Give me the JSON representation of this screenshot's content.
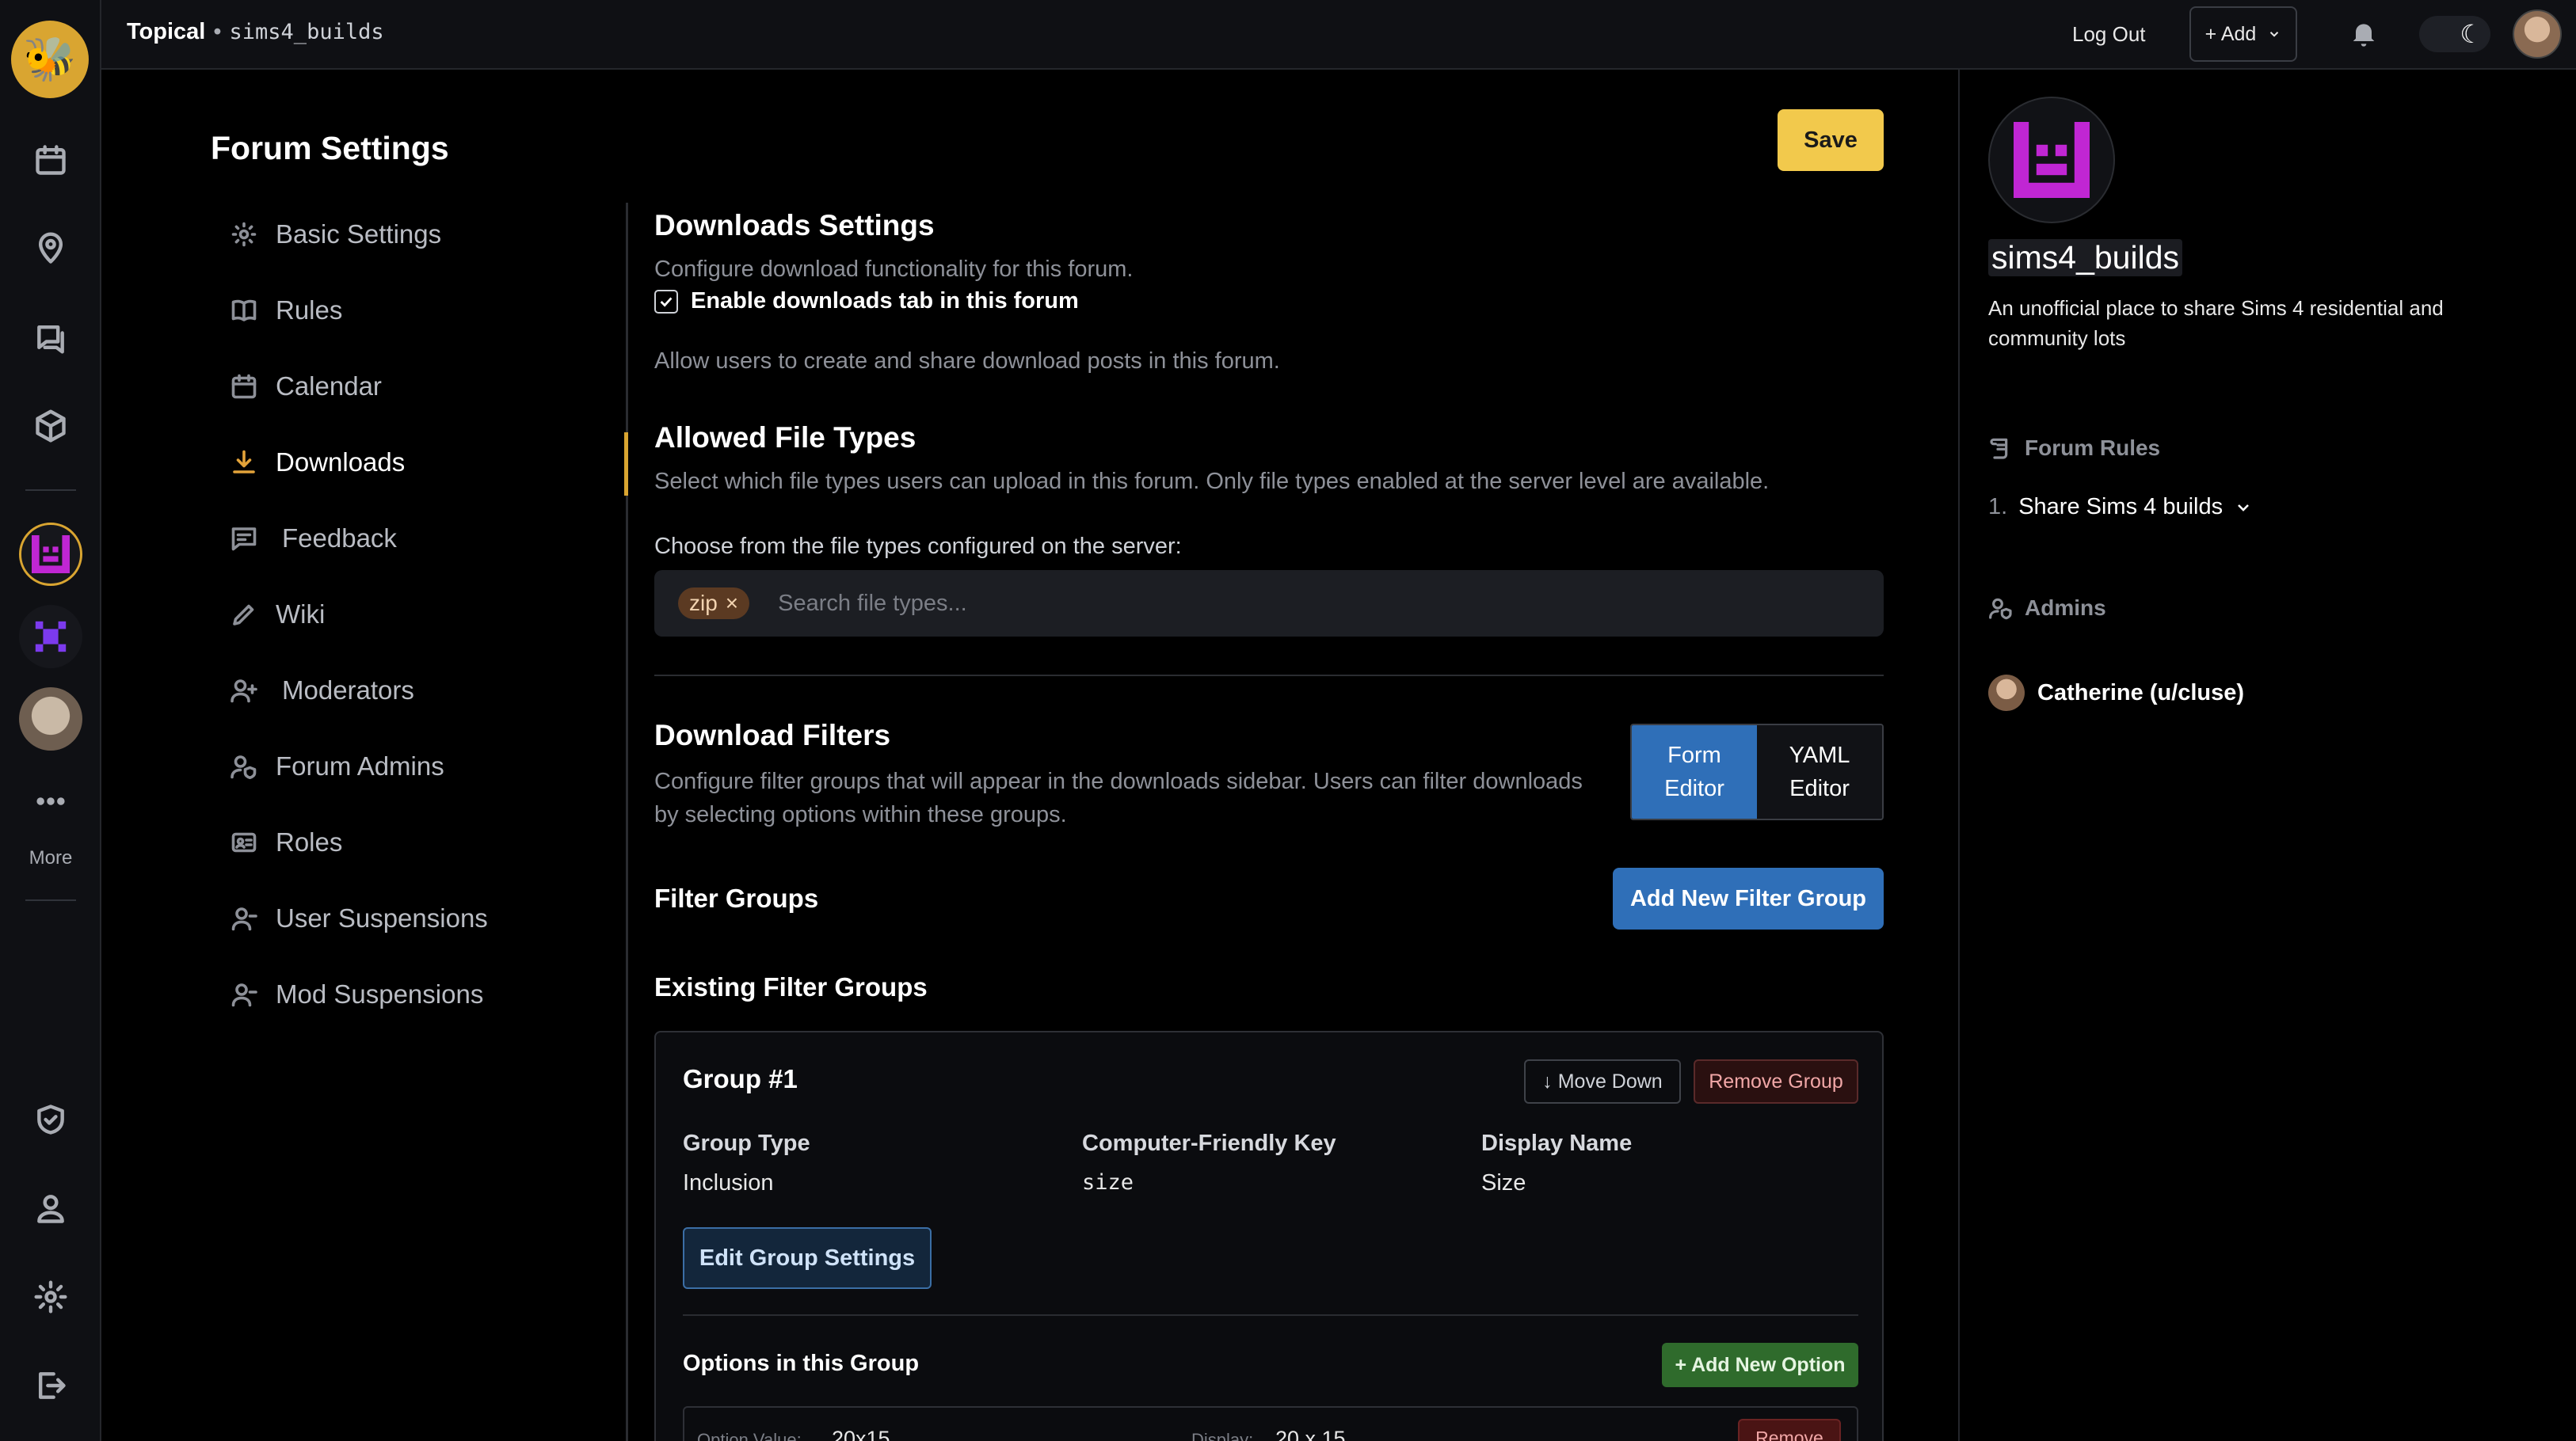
{
  "topbar": {
    "brand": "Topical",
    "separator": "•",
    "forum": "sims4_builds",
    "logout": "Log Out",
    "add": "+ Add"
  },
  "rail": {
    "more_label": "More"
  },
  "settings": {
    "title": "Forum Settings",
    "nav": [
      {
        "label": "Basic Settings",
        "icon": "gear-icon"
      },
      {
        "label": "Rules",
        "icon": "book-icon"
      },
      {
        "label": "Calendar",
        "icon": "calendar-icon"
      },
      {
        "label": "Downloads",
        "icon": "download-icon",
        "active": true
      },
      {
        "label": "Feedback",
        "icon": "message-icon"
      },
      {
        "label": "Wiki",
        "icon": "pencil-icon"
      },
      {
        "label": "Moderators",
        "icon": "user-plus-icon"
      },
      {
        "label": "Forum Admins",
        "icon": "user-shield-icon"
      },
      {
        "label": "Roles",
        "icon": "id-card-icon"
      },
      {
        "label": "User Suspensions",
        "icon": "user-icon"
      },
      {
        "label": "Mod Suspensions",
        "icon": "user-icon"
      }
    ]
  },
  "main": {
    "save": "Save",
    "downloads_title": "Downloads Settings",
    "downloads_desc": "Configure download functionality for this forum.",
    "enable_label": "Enable downloads tab in this forum",
    "enable_checked": true,
    "enable_help": "Allow users to create and share download posts in this forum.",
    "filetypes_title": "Allowed File Types",
    "filetypes_desc": "Select which file types users can upload in this forum. Only file types enabled at the server level are available.",
    "filetypes_label": "Choose from the file types configured on the server:",
    "filetypes_tag": "zip",
    "filetypes_tag_remove": "×",
    "filetypes_placeholder": "Search file types...",
    "filters_title": "Download Filters",
    "filters_desc": "Configure filter groups that will appear in the downloads sidebar. Users can filter downloads by selecting options within these groups.",
    "form_editor": "Form\nEditor",
    "yaml_editor": "YAML\nEditor",
    "filter_groups_title": "Filter Groups",
    "add_filter_group": "Add New Filter Group",
    "existing_title": "Existing Filter Groups",
    "group": {
      "title": "Group #1",
      "move_down": "↓ Move Down",
      "remove": "Remove Group",
      "type_label": "Group Type",
      "type_value": "Inclusion",
      "key_label": "Computer-Friendly Key",
      "key_value": "size",
      "display_label": "Display Name",
      "display_value": "Size",
      "edit": "Edit Group Settings",
      "options_title": "Options in this Group",
      "add_option": "+ Add New Option",
      "option": {
        "value_label": "Option Value:",
        "value": "20x15",
        "display_label": "Display:",
        "display": "20 x 15",
        "remove": "Remove"
      }
    }
  },
  "sidebar": {
    "forum_name": "sims4_builds",
    "description": "An unofficial place to share Sims 4 residential and community lots",
    "rules_title": "Forum Rules",
    "rules": [
      {
        "num": "1.",
        "text": "Share Sims 4 builds"
      }
    ],
    "admins_title": "Admins",
    "admins": [
      {
        "name": "Catherine (u/cluse)"
      }
    ]
  },
  "colors": {
    "accent": "#d9a531",
    "save": "#f2c94c",
    "primary": "#2f6fb8",
    "success": "#2f6b2c",
    "forum_icon": "#c026d3"
  }
}
